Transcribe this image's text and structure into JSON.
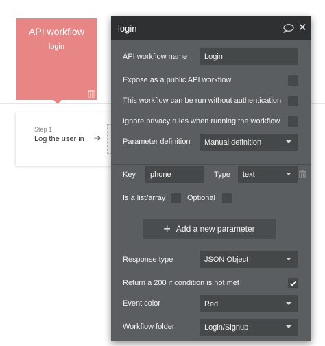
{
  "event": {
    "title": "API workflow",
    "name": "login",
    "color": "#e88585"
  },
  "step": {
    "number": "Step 1",
    "action": "Log the user in"
  },
  "panel": {
    "title": "login",
    "fields": {
      "workflow_name": {
        "label": "API workflow name",
        "value": "Login"
      },
      "expose_public": {
        "label": "Expose as a public API workflow",
        "checked": false
      },
      "run_without_auth": {
        "label": "This workflow can be run without authentication",
        "checked": false
      },
      "ignore_privacy": {
        "label": "Ignore privacy rules when running the workflow",
        "checked": false
      },
      "param_definition": {
        "label": "Parameter definition",
        "value": "Manual definition"
      }
    },
    "parameter": {
      "key_label": "Key",
      "key_value": "phone",
      "type_label": "Type",
      "type_value": "text",
      "is_list_label": "Is a list/array",
      "is_list_checked": false,
      "optional_label": "Optional",
      "optional_checked": false
    },
    "add_param_label": "Add a new parameter",
    "response": {
      "response_type": {
        "label": "Response type",
        "value": "JSON Object"
      },
      "return_200": {
        "label": "Return a 200 if condition is not met",
        "checked": true
      },
      "event_color": {
        "label": "Event color",
        "value": "Red"
      },
      "workflow_folder": {
        "label": "Workflow folder",
        "value": "Login/Signup"
      }
    }
  },
  "icons": [
    "trash-icon",
    "arrow-right-icon",
    "comment-icon",
    "close-icon",
    "plus-icon",
    "checkmark-icon",
    "chevron-down-icon"
  ]
}
